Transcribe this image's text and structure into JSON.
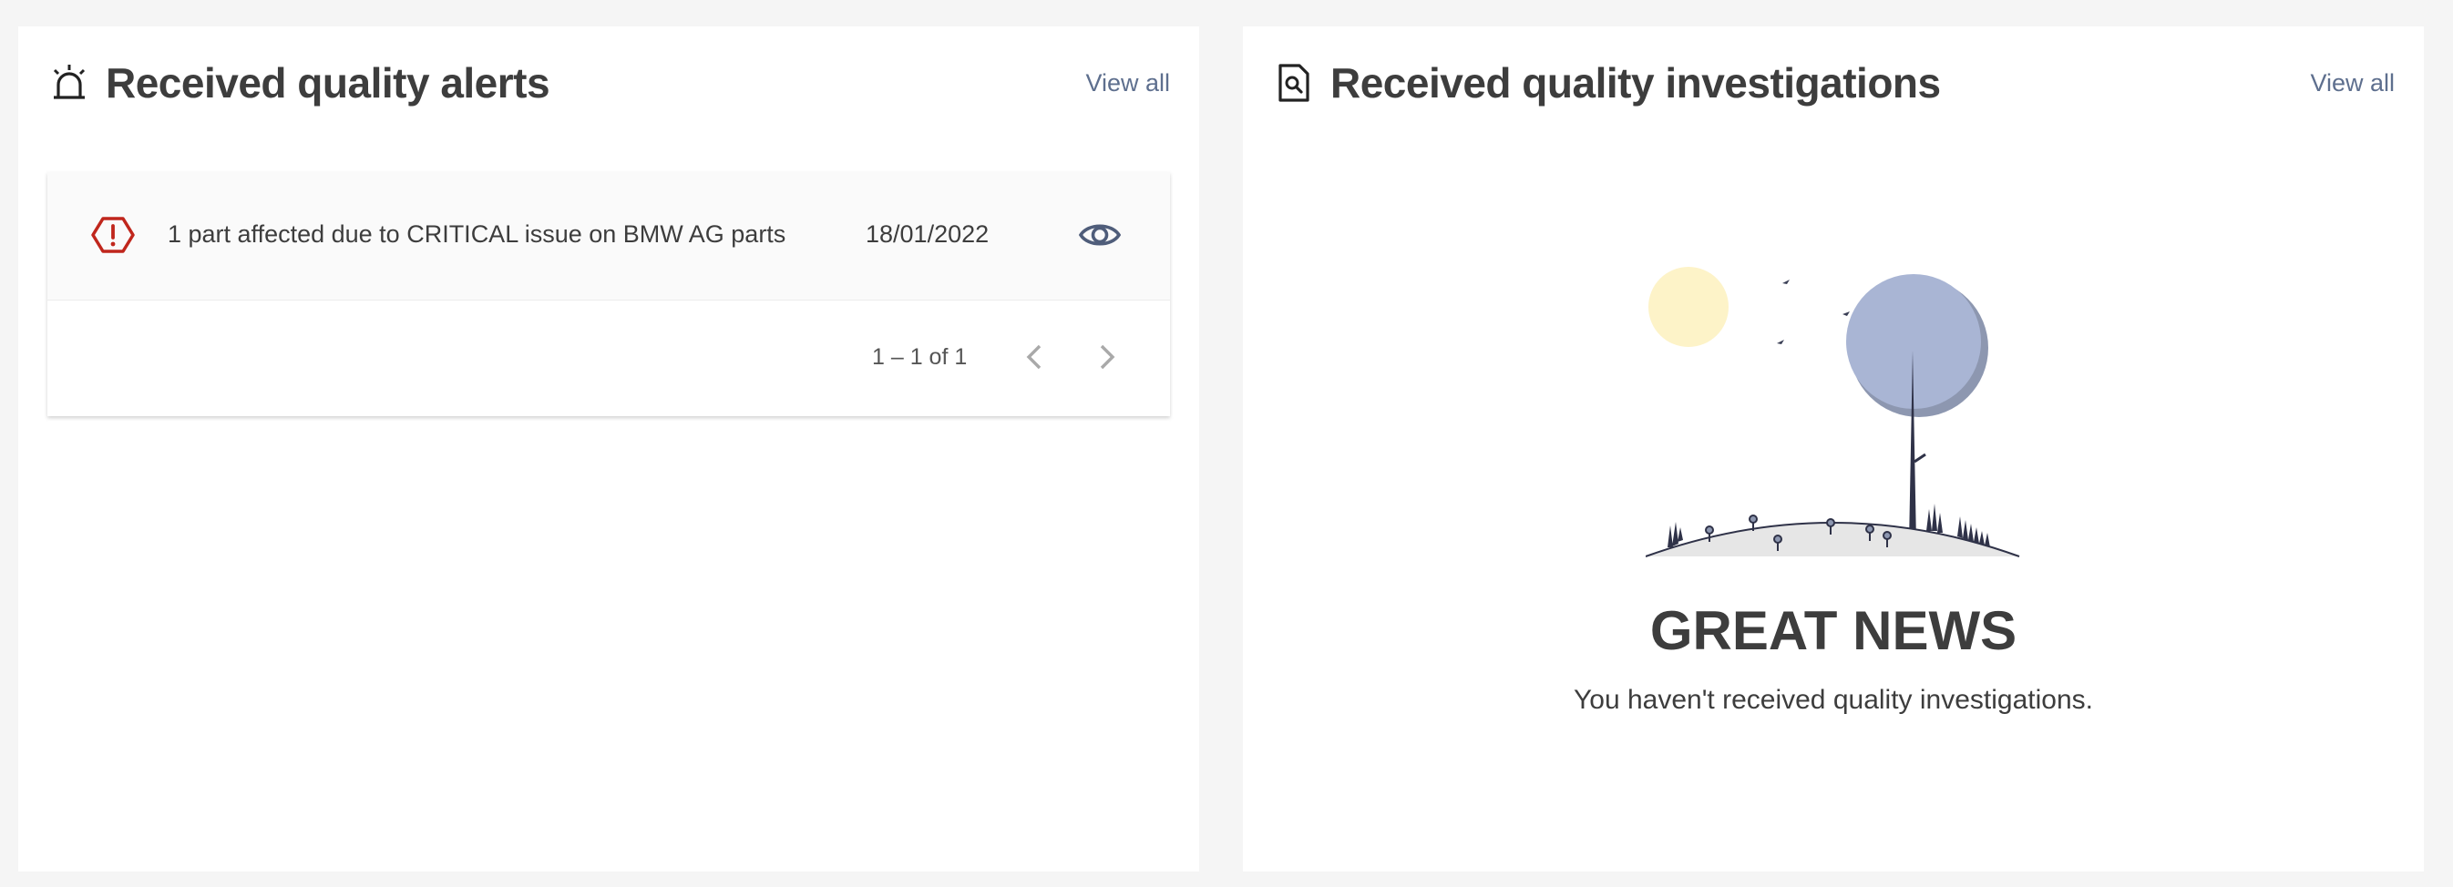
{
  "alerts_card": {
    "title": "Received quality alerts",
    "view_all": "View all",
    "icon": "alarm-bell-icon",
    "rows": [
      {
        "severity": "CRITICAL",
        "severity_icon": "critical-hexagon-icon",
        "text": "1 part affected due to CRITICAL issue on BMW AG parts",
        "date": "18/01/2022",
        "action_icon": "eye-icon"
      }
    ],
    "paginator": {
      "range_label": "1 – 1 of 1",
      "prev_icon": "chevron-left-icon",
      "next_icon": "chevron-right-icon"
    }
  },
  "investigations_card": {
    "title": "Received quality investigations",
    "view_all": "View all",
    "icon": "document-search-icon",
    "empty_state": {
      "title": "GREAT NEWS",
      "subtitle": "You haven't received quality investigations."
    }
  },
  "colors": {
    "accent_link": "#5e6f8e",
    "critical": "#c0261c",
    "sun": "#fdf3c8",
    "tree": "#a9b5d4"
  }
}
